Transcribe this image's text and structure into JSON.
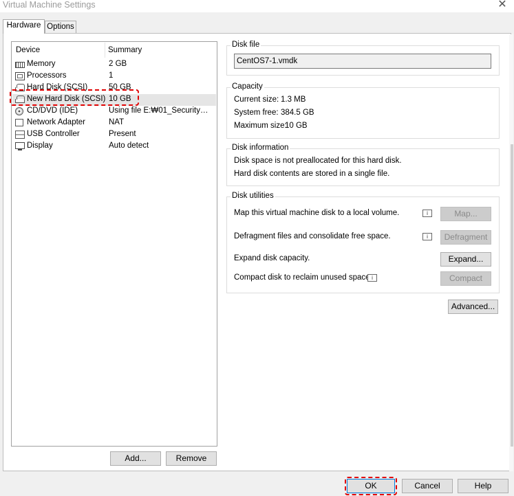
{
  "window": {
    "title": "Virtual Machine Settings",
    "close_glyph": "✕"
  },
  "tabs": [
    {
      "label": "Hardware",
      "selected": true
    },
    {
      "label": "Options",
      "selected": false
    }
  ],
  "device_list": {
    "headers": {
      "device": "Device",
      "summary": "Summary"
    },
    "rows": [
      {
        "device": "Memory",
        "summary": "2 GB",
        "icon": "memory-icon"
      },
      {
        "device": "Processors",
        "summary": "1",
        "icon": "processor-icon"
      },
      {
        "device": "Hard Disk (SCSI)",
        "summary": "50 GB",
        "icon": "hard-disk-icon"
      },
      {
        "device": "New Hard Disk (SCSI)",
        "summary": "10 GB",
        "icon": "hard-disk-icon",
        "selected": true
      },
      {
        "device": "CD/DVD (IDE)",
        "summary": "Using file E:₩01_Security₩...",
        "icon": "cd-dvd-icon"
      },
      {
        "device": "Network Adapter",
        "summary": "NAT",
        "icon": "network-adapter-icon"
      },
      {
        "device": "USB Controller",
        "summary": "Present",
        "icon": "usb-icon"
      },
      {
        "device": "Display",
        "summary": "Auto detect",
        "icon": "monitor-icon"
      }
    ],
    "add_label": "Add...",
    "remove_label": "Remove"
  },
  "disk_file": {
    "group_label": "Disk file",
    "value": "CentOS7-1.vmdk"
  },
  "capacity": {
    "group_label": "Capacity",
    "current_size_label": "Current size:",
    "current_size_value": "1.3 MB",
    "system_free_label": "System free:",
    "system_free_value": "384.5 GB",
    "maximum_size_label": "Maximum size:",
    "maximum_size_value": "10 GB"
  },
  "disk_information": {
    "group_label": "Disk information",
    "line1": "Disk space is not preallocated for this hard disk.",
    "line2": "Hard disk contents are stored in a single file."
  },
  "disk_utilities": {
    "group_label": "Disk utilities",
    "map_text": "Map this virtual machine disk to a local volume.",
    "map_button": "Map...",
    "defrag_text": "Defragment files and consolidate free space.",
    "defrag_button": "Defragment",
    "expand_text": "Expand disk capacity.",
    "expand_button": "Expand...",
    "compact_text": "Compact disk to reclaim unused space.",
    "compact_button": "Compact",
    "info_glyph": "i"
  },
  "advanced_button": "Advanced...",
  "footer": {
    "ok": "OK",
    "cancel": "Cancel",
    "help": "Help"
  },
  "colors": {
    "annotation": "#e00000",
    "selected_row": "#e5e5e5",
    "focus_border": "#0078d7"
  }
}
